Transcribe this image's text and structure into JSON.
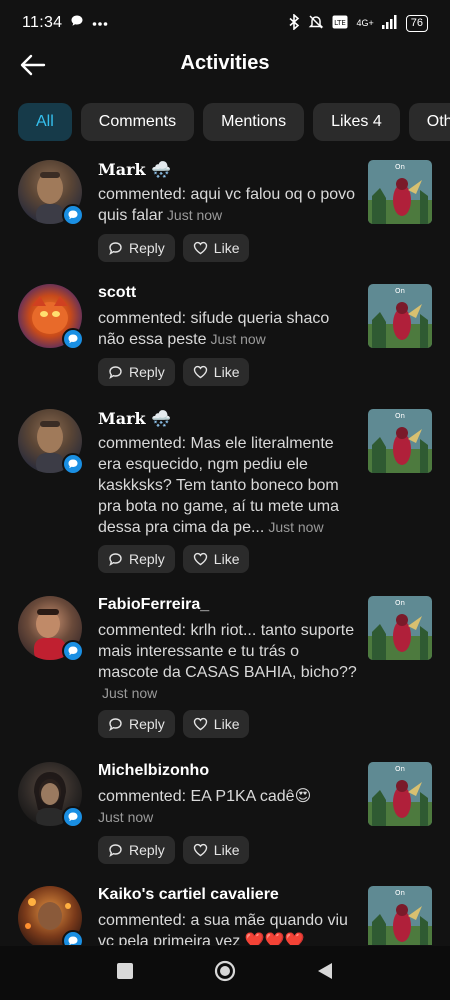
{
  "status_bar": {
    "time": "11:34",
    "battery": "76",
    "network": "4G+",
    "volte": "Vo LTE"
  },
  "header": {
    "title": "Activities"
  },
  "tabs": [
    {
      "label": "All",
      "active": true
    },
    {
      "label": "Comments",
      "active": false
    },
    {
      "label": "Mentions",
      "active": false
    },
    {
      "label": "Likes 4",
      "active": false
    },
    {
      "label": "Oth",
      "active": false
    }
  ],
  "actions": {
    "reply_label": "Reply",
    "like_label": "Like"
  },
  "activities": [
    {
      "name": "Mark",
      "name_emoji": "🌨️",
      "text": "commented: aqui vc falou oq o povo quis falar",
      "time": "Just now"
    },
    {
      "name": "scott",
      "text": "commented: sifude queria shaco não essa peste",
      "time": "Just now"
    },
    {
      "name": "Mark",
      "name_emoji": "🌨️",
      "text": "commented: Mas ele literalmente era esquecido, ngm pediu ele kaskksks? Tem tanto boneco bom pra bota no game, aí tu mete uma dessa pra cima da pe...",
      "time": "Just now"
    },
    {
      "name": "FabioFerreira_",
      "text": "commented: krlh riot... tanto suporte mais interessante e tu trás o mascote da CASAS BAHIA, bicho??",
      "time": "Just now"
    },
    {
      "name": "Michelbizonho",
      "text": "commented: EA P1KA cadê😍",
      "time": "Just now"
    },
    {
      "name": "Kaiko's cartiel cavaliere",
      "text": "commented: a sua mãe quando viu vc pela primeira vez ❤️❤️❤️",
      "time": ""
    }
  ],
  "thumbnail_caption": "On",
  "colors": {
    "background": "#121212",
    "tab_active_bg": "#163a49",
    "tab_active_text": "#35c0ee",
    "chip_bg": "#2b2b2b",
    "badge": "#1a8fe3"
  }
}
